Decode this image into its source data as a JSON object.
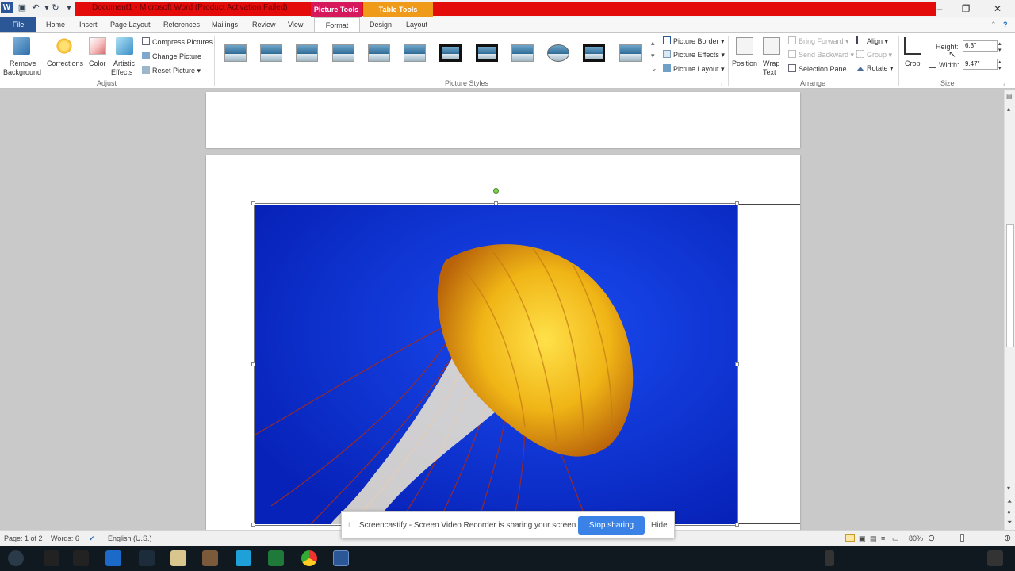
{
  "window": {
    "title": "Document1 - Microsoft Word (Product Activation Failed)",
    "contextual_tabs": {
      "picture_tools": "Picture Tools",
      "table_tools": "Table Tools"
    }
  },
  "tabs": {
    "file": "File",
    "home": "Home",
    "insert": "Insert",
    "page_layout": "Page Layout",
    "references": "References",
    "mailings": "Mailings",
    "review": "Review",
    "view": "View",
    "format": "Format",
    "design": "Design",
    "layout": "Layout"
  },
  "ribbon": {
    "adjust": {
      "remove_bg_line1": "Remove",
      "remove_bg_line2": "Background",
      "corrections": "Corrections",
      "color": "Color",
      "artistic_line1": "Artistic",
      "artistic_line2": "Effects",
      "compress": "Compress Pictures",
      "change": "Change Picture",
      "reset": "Reset Picture",
      "group_label": "Adjust"
    },
    "picture_styles": {
      "group_label": "Picture Styles",
      "border": "Picture Border",
      "effects": "Picture Effects",
      "layout": "Picture Layout"
    },
    "arrange": {
      "group_label": "Arrange",
      "position": "Position",
      "wrap_line1": "Wrap",
      "wrap_line2": "Text",
      "bring_forward": "Bring Forward",
      "send_backward": "Send Backward",
      "selection_pane": "Selection Pane",
      "align": "Align",
      "group": "Group",
      "rotate": "Rotate"
    },
    "size": {
      "group_label": "Size",
      "crop": "Crop",
      "height_label": "Height:",
      "height_value": "6.3\"",
      "width_label": "Width:",
      "width_value": "9.47\""
    }
  },
  "status": {
    "page": "Page: 1 of 2",
    "words": "Words: 6",
    "language": "English (U.S.)",
    "zoom": "80%"
  },
  "share_banner": {
    "message": "Screencastify - Screen Video Recorder is sharing your screen.",
    "stop": "Stop sharing",
    "hide": "Hide"
  },
  "colors": {
    "title_bar_red": "#e40b0b",
    "picture_tools": "#d6175c",
    "table_tools": "#f09a1a",
    "file_tab": "#2b5797",
    "stop_button": "#3b82e7"
  }
}
